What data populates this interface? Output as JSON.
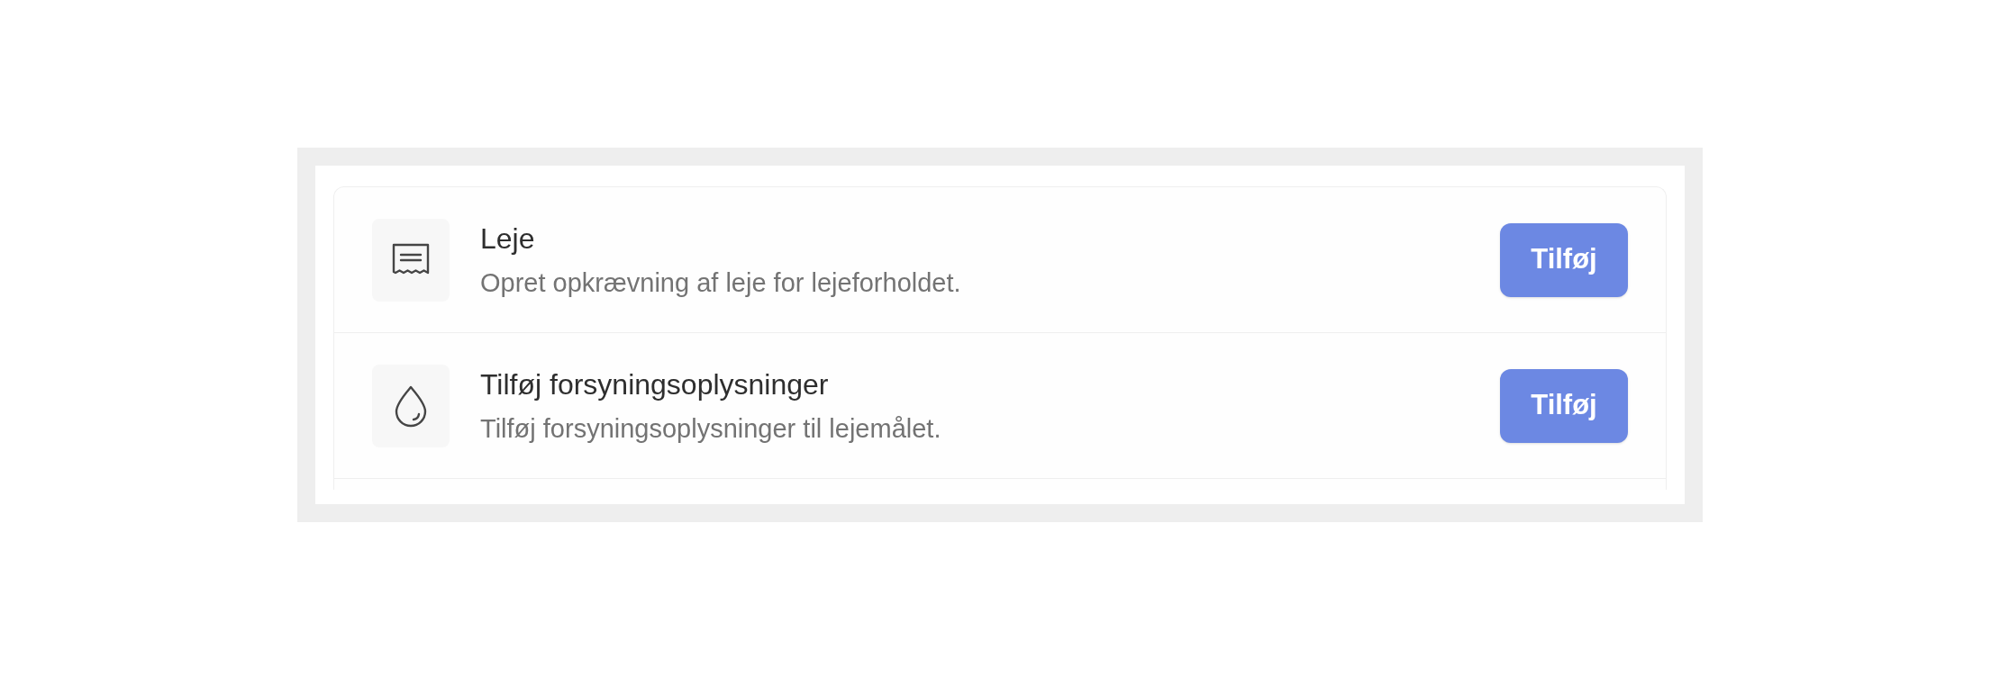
{
  "items": [
    {
      "kind": "rent",
      "title": "Leje",
      "description": "Opret opkrævning af leje for lejeforholdet.",
      "button": "Tilføj"
    },
    {
      "kind": "utility",
      "title": "Tilføj forsyningsoplysninger",
      "description": "Tilføj forsyningsoplysninger til lejemålet.",
      "button": "Tilføj"
    }
  ]
}
